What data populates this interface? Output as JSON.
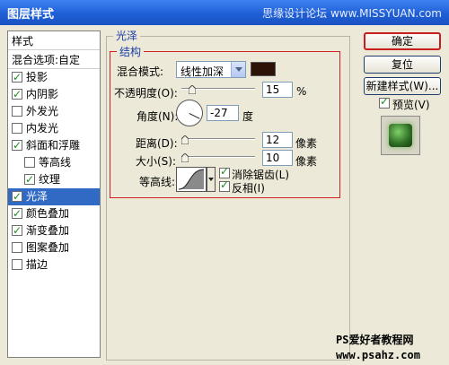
{
  "window": {
    "title": "图层样式",
    "watermark_top": "思缘设计论坛 www.MISSYUAN.com"
  },
  "style_list": {
    "header": "样式",
    "items": [
      {
        "label": "混合选项:自定",
        "checkbox": false,
        "checked": false,
        "selected": false,
        "indent": false
      },
      {
        "label": "投影",
        "checkbox": true,
        "checked": true,
        "selected": false,
        "indent": false
      },
      {
        "label": "内阴影",
        "checkbox": true,
        "checked": true,
        "selected": false,
        "indent": false
      },
      {
        "label": "外发光",
        "checkbox": true,
        "checked": false,
        "selected": false,
        "indent": false
      },
      {
        "label": "内发光",
        "checkbox": true,
        "checked": false,
        "selected": false,
        "indent": false
      },
      {
        "label": "斜面和浮雕",
        "checkbox": true,
        "checked": true,
        "selected": false,
        "indent": false
      },
      {
        "label": "等高线",
        "checkbox": true,
        "checked": false,
        "selected": false,
        "indent": true
      },
      {
        "label": "纹理",
        "checkbox": true,
        "checked": true,
        "selected": false,
        "indent": true
      },
      {
        "label": "光泽",
        "checkbox": true,
        "checked": true,
        "selected": true,
        "indent": false
      },
      {
        "label": "颜色叠加",
        "checkbox": true,
        "checked": true,
        "selected": false,
        "indent": false
      },
      {
        "label": "渐变叠加",
        "checkbox": true,
        "checked": true,
        "selected": false,
        "indent": false
      },
      {
        "label": "图案叠加",
        "checkbox": true,
        "checked": false,
        "selected": false,
        "indent": false
      },
      {
        "label": "描边",
        "checkbox": true,
        "checked": false,
        "selected": false,
        "indent": false
      }
    ]
  },
  "satin": {
    "section_title": "光泽",
    "subsection_title": "结构",
    "blend_mode": {
      "label": "混合模式:",
      "value": "线性加深",
      "color": "#2b1308"
    },
    "opacity": {
      "label": "不透明度(O):",
      "value": "15",
      "unit": "%",
      "level": 0.15
    },
    "angle": {
      "label": "角度(N):",
      "value": "-27",
      "unit": "度",
      "degrees": -27
    },
    "distance": {
      "label": "距离(D):",
      "value": "12",
      "unit": "像素",
      "level": 0.05
    },
    "size": {
      "label": "大小(S):",
      "value": "10",
      "unit": "像素",
      "level": 0.05
    },
    "contour": {
      "label": "等高线:"
    },
    "anti_aliased": {
      "label": "消除锯齿(L)",
      "checked": true
    },
    "invert": {
      "label": "反相(I)",
      "checked": true
    }
  },
  "buttons": {
    "ok": "确定",
    "reset": "复位",
    "new_style": "新建样式(W)...",
    "preview_label": "预览(V)",
    "preview_checked": true
  },
  "watermark_bottom": {
    "line1": "PS爱好者教程网",
    "line2": "www.psahz.com"
  }
}
